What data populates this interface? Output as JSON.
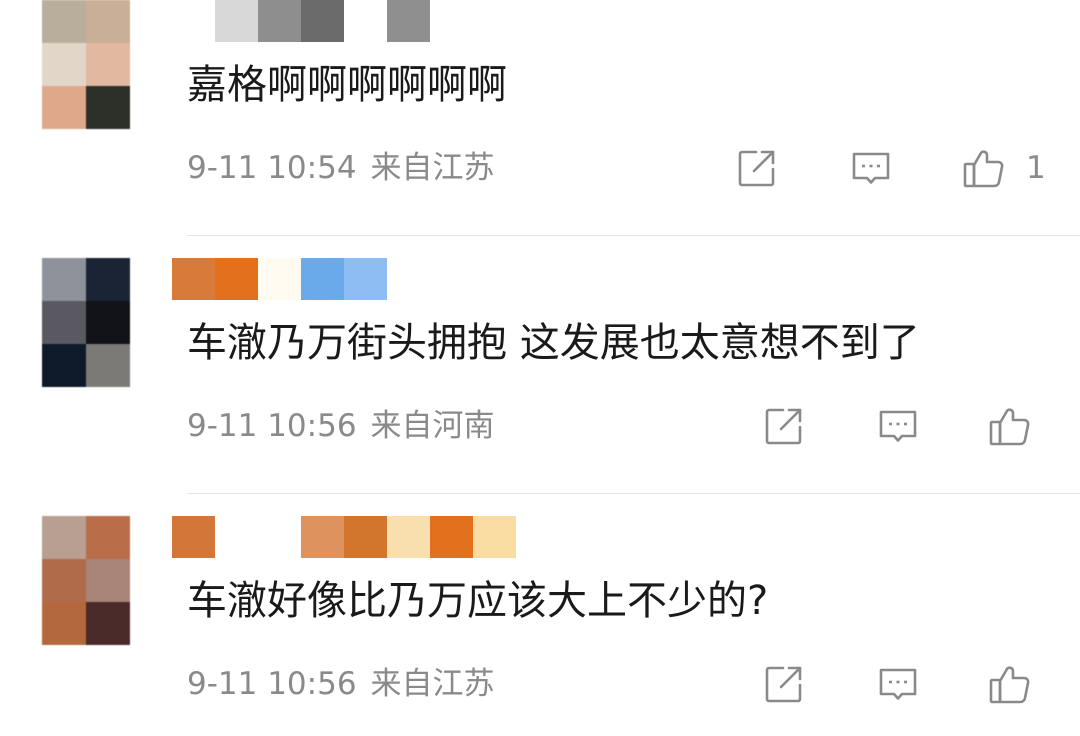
{
  "comments": [
    {
      "avatar_pixels": [
        "#b9ad9c",
        "#c9ae98",
        "#e2d6c9",
        "#e2b8a0",
        "#dfa88a",
        "#2c3028"
      ],
      "username_pixels": [
        "#ffffff",
        "#d8d8d8",
        "#8e8e8e",
        "#6b6b6b",
        "#ffffff",
        "#8f8f8f"
      ],
      "text": "嘉格啊啊啊啊啊啊",
      "date": "9-11 10:54",
      "location": "来自江苏",
      "like_count": "1"
    },
    {
      "avatar_pixels": [
        "#8f929a",
        "#1b2434",
        "#5a5860",
        "#121318",
        "#0e1a2a",
        "#7c7a76"
      ],
      "username_pixels": [
        "#d87a3a",
        "#e2701c",
        "#fffbf0",
        "#6aa9ea",
        "#8dbdf2"
      ],
      "text": "车澈乃万街头拥抱 这发展也太意想不到了",
      "date": "9-11 10:56",
      "location": "来自河南",
      "like_count": ""
    },
    {
      "avatar_pixels": [
        "#b89f92",
        "#b86e48",
        "#b06c4a",
        "#a88478",
        "#b4683e",
        "#4a2a28"
      ],
      "username_pixels": [
        "#d2763a",
        "#ffffff",
        "#ffffff",
        "#de925e",
        "#d2762e",
        "#f9dfae",
        "#e2701c",
        "#f9dca2"
      ],
      "text": "车澈好像比乃万应该大上不少的?",
      "date": "9-11 10:56",
      "location": "来自江苏",
      "like_count": ""
    }
  ],
  "icons": {
    "repost": "share-icon",
    "reply": "comment-icon",
    "like": "thumbs-up-icon"
  },
  "colors": {
    "text": "#1a1a1a",
    "meta": "#8a8a8a",
    "icon": "#8a8a8a",
    "divider": "#e6e6e6"
  }
}
